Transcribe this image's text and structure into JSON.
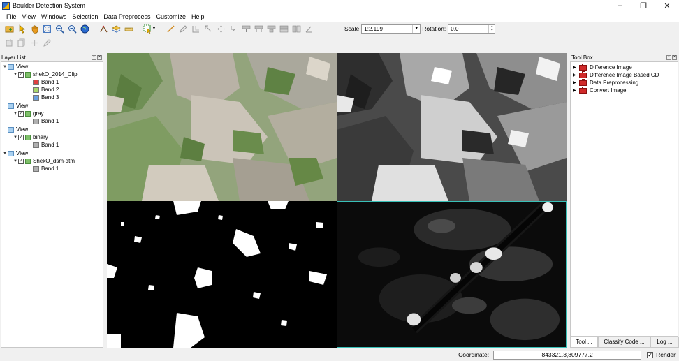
{
  "window": {
    "title": "Boulder Detection System",
    "controls": {
      "minimize": "–",
      "restore": "❐",
      "close": "✕"
    }
  },
  "menu": [
    "File",
    "View",
    "Windows",
    "Selection",
    "Data Preprocess",
    "Customize",
    "Help"
  ],
  "toolbar": {
    "scale_label": "Scale",
    "scale_value": "1:2,199",
    "rotation_label": "Rotation:",
    "rotation_value": "0.0"
  },
  "layer_panel": {
    "title": "Layer List",
    "views": [
      {
        "label": "View",
        "layer": "shekO_2014_Clip",
        "bands": [
          {
            "name": "Band 1",
            "color": "#e04040"
          },
          {
            "name": "Band 2",
            "color": "#a8d86a"
          },
          {
            "name": "Band 3",
            "color": "#6aa0e0"
          }
        ]
      },
      {
        "label": "View",
        "layer": "gray",
        "bands": [
          {
            "name": "Band 1",
            "color": "#b0b0b0"
          }
        ]
      },
      {
        "label": "View",
        "layer": "binary",
        "bands": [
          {
            "name": "Band 1",
            "color": "#b0b0b0"
          }
        ]
      },
      {
        "label": "View",
        "layer": "ShekO_dsm-dtm",
        "bands": [
          {
            "name": "Band 1",
            "color": "#b0b0b0"
          }
        ]
      }
    ]
  },
  "toolbox": {
    "title": "Tool Box",
    "items": [
      "Difference Image",
      "Difference Image Based CD",
      "Data Preprocessing",
      "Convert Image"
    ],
    "tabs": [
      "Tool ...",
      "Classify Code ...",
      "Log ..."
    ]
  },
  "status": {
    "coordinate_label": "Coordinate:",
    "coordinate_value": "843321.3,809777.2",
    "render_label": "Render"
  },
  "colors": {
    "accent_border": "#39c0b8"
  }
}
